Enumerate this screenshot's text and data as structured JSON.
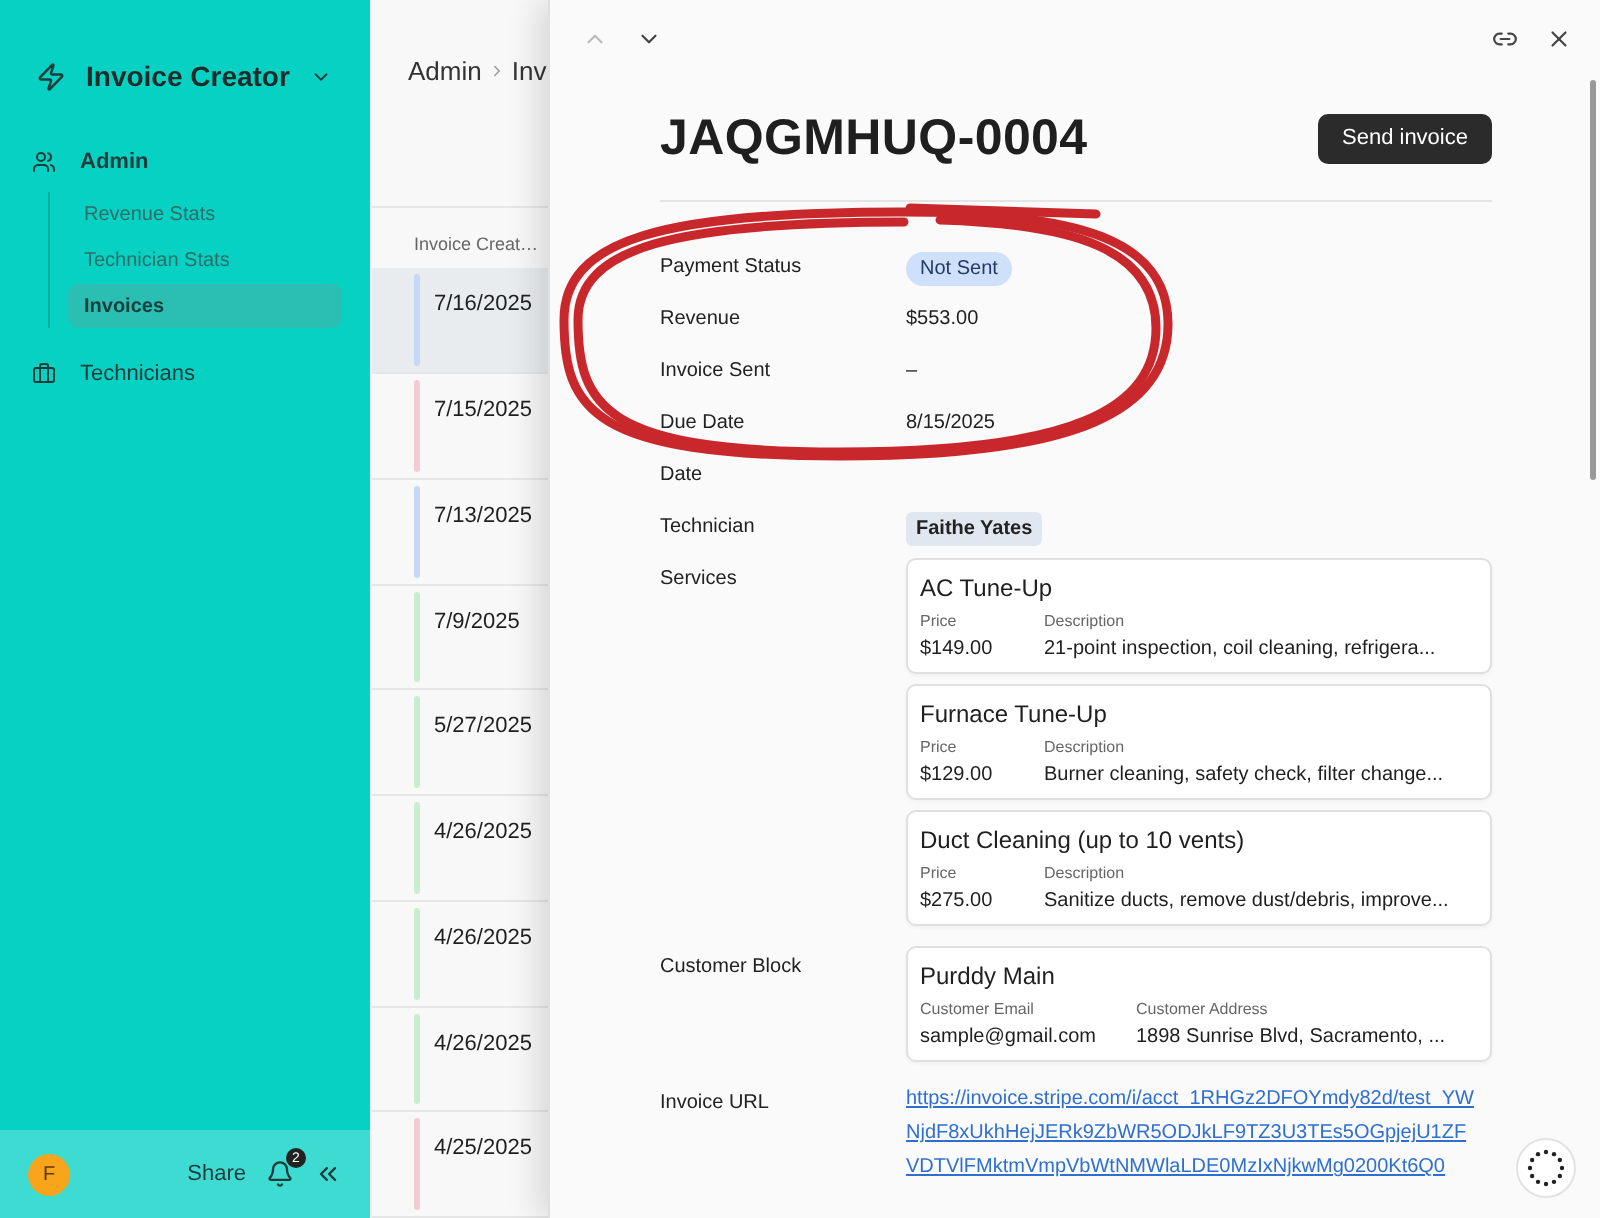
{
  "sidebar": {
    "app_title": "Invoice Creator",
    "groups": [
      {
        "label": "Admin",
        "children": [
          {
            "label": "Revenue Stats",
            "selected": false
          },
          {
            "label": "Technician Stats",
            "selected": false
          },
          {
            "label": "Invoices",
            "selected": true
          }
        ]
      },
      {
        "label": "Technicians"
      }
    ],
    "footer": {
      "avatar": "F",
      "share": "Share",
      "notifications": "2"
    }
  },
  "list": {
    "breadcrumb": [
      "Admin",
      "Inv"
    ],
    "column": "Invoice Creat…",
    "rows": [
      {
        "date": "7/16/2025",
        "color": "#c7d7f7",
        "selected": true
      },
      {
        "date": "7/15/2025",
        "color": "#f6c9d3",
        "selected": false
      },
      {
        "date": "7/13/2025",
        "color": "#c7d7f7",
        "selected": false
      },
      {
        "date": "7/9/2025",
        "color": "#c9edcf",
        "selected": false
      },
      {
        "date": "5/27/2025",
        "color": "#c9edcf",
        "selected": false
      },
      {
        "date": "4/26/2025",
        "color": "#c9edcf",
        "selected": false
      },
      {
        "date": "4/26/2025",
        "color": "#c9edcf",
        "selected": false
      },
      {
        "date": "4/26/2025",
        "color": "#c9edcf",
        "selected": false
      },
      {
        "date": "4/25/2025",
        "color": "#f6c9d3",
        "selected": false
      }
    ]
  },
  "detail": {
    "nav": {
      "previous_disabled": true,
      "next_disabled": false
    },
    "title": "JAQGMHUQ-0004",
    "send_button": "Send invoice",
    "fields": [
      {
        "kind": "pill",
        "label": "Payment Status",
        "value": "Not Sent"
      },
      {
        "kind": "text",
        "label": "Revenue",
        "value": "$553.00"
      },
      {
        "kind": "text",
        "label": "Invoice Sent",
        "value": "–"
      },
      {
        "kind": "text",
        "label": "Due Date",
        "value": "8/15/2025"
      },
      {
        "kind": "text",
        "label": "Date"
      },
      {
        "kind": "tag",
        "label": "Technician",
        "value": "Faithe Yates"
      },
      {
        "kind": "services",
        "label": "Services",
        "items": [
          {
            "name": "AC Tune-Up",
            "price_label": "Price",
            "description_label": "Description",
            "price": "$149.00",
            "description": "21-point inspection, coil cleaning, refrigera..."
          },
          {
            "name": "Furnace Tune-Up",
            "price_label": "Price",
            "description_label": "Description",
            "price": "$129.00",
            "description": "Burner cleaning, safety check, filter change..."
          },
          {
            "name": "Duct Cleaning (up to 10 vents)",
            "price_label": "Price",
            "description_label": "Description",
            "price": "$275.00",
            "description": "Sanitize ducts, remove dust/debris, improve..."
          }
        ]
      },
      {
        "kind": "customer",
        "label": "Customer Block",
        "name": "Purddy Main",
        "email_label": "Customer Email",
        "email": "sample@gmail.com",
        "address_label": "Customer Address",
        "address": "1898 Sunrise Blvd, Sacramento, ..."
      },
      {
        "kind": "link",
        "label": "Invoice URL",
        "value": "https://invoice.stripe.com/i/acct_1RHGz2DFOYmdy82d/test_YWNjdF8xUkhHejJERk9ZbWR5ODJkLF9TZ3U3TEs5OGpjejU1ZFVDTVlFMktmVmpVbWtNMWlaLDE0MzIxNjkwMg0200Kt6Q0"
      }
    ]
  }
}
